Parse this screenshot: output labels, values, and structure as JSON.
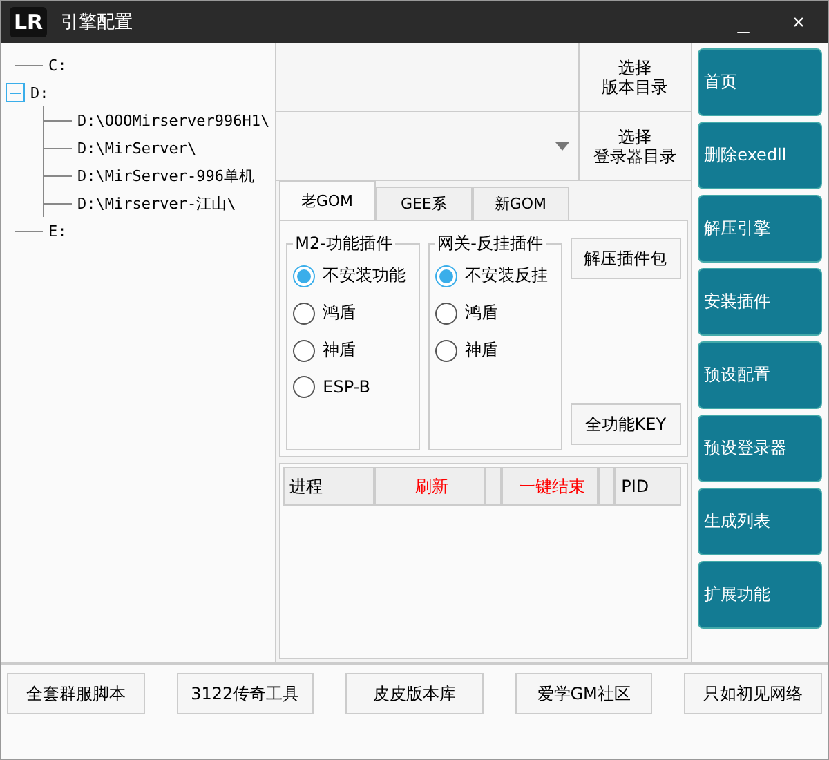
{
  "window": {
    "logo": "LR",
    "title": "引擎配置",
    "buttons": [
      "_",
      "×"
    ]
  },
  "tree": [
    {
      "label": "C:"
    },
    {
      "label": "D:",
      "expanded": true,
      "children": [
        {
          "label": "D:\\OOOMirserver996H1\\"
        },
        {
          "label": "D:\\MirServer\\"
        },
        {
          "label": "D:\\MirServer-996单机"
        },
        {
          "label": "D:\\Mirserver-江山\\"
        }
      ]
    },
    {
      "label": "E:"
    }
  ],
  "version_dir": {
    "button": [
      "选择",
      "版本目录"
    ]
  },
  "login_dir": {
    "button": [
      "选择",
      "登录器目录"
    ]
  },
  "tabs": [
    {
      "label": "老GOM",
      "selected": true
    },
    {
      "label": "GEE系",
      "selected": false
    },
    {
      "label": "新GOM",
      "selected": false
    }
  ],
  "groups": [
    {
      "title": "M2-功能插件",
      "options": [
        {
          "label": "不安装功能",
          "selected": true
        },
        {
          "label": "鸿盾",
          "selected": false
        },
        {
          "label": "神盾",
          "selected": false
        },
        {
          "label": "ESP-B",
          "selected": false
        }
      ]
    },
    {
      "title": "网关-反挂插件",
      "options": [
        {
          "label": "不安装反挂",
          "selected": true
        },
        {
          "label": "鸿盾",
          "selected": false
        },
        {
          "label": "神盾",
          "selected": false
        }
      ]
    }
  ],
  "panel_buttons": [
    "解压插件包",
    "全功能KEY"
  ],
  "process_table": {
    "columns": [
      {
        "label": "进程",
        "kind": "header"
      },
      {
        "label": "刷新",
        "kind": "action"
      },
      {
        "kind": "blank"
      },
      {
        "label": "一键结束",
        "kind": "action"
      },
      {
        "kind": "blank"
      },
      {
        "label": "PID",
        "kind": "header"
      }
    ]
  },
  "side_menu": [
    "首页",
    "删除exedll",
    "解压引擎",
    "安装插件",
    "预设配置",
    "预设登录器",
    "生成列表",
    "扩展功能"
  ],
  "footer_buttons": [
    "全套群服脚本",
    "3122传奇工具",
    "皮皮版本库",
    "爱学GM社区",
    "只如初见网络"
  ]
}
